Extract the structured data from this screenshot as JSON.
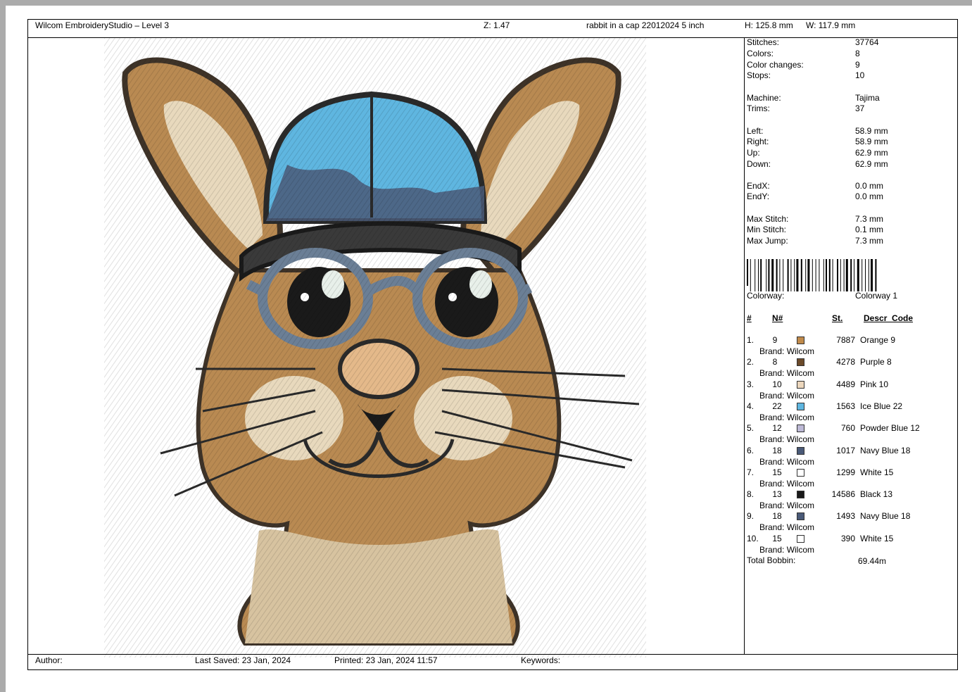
{
  "header": {
    "app": "Wilcom EmbroideryStudio – Level 3",
    "zoom": "Z: 1.47",
    "design_name": "rabbit in a cap 22012024 5 inch",
    "height": "H: 125.8 mm",
    "width": "W: 117.9 mm"
  },
  "stats": [
    {
      "label": "Stitches:",
      "value": "37764"
    },
    {
      "label": "Colors:",
      "value": "8"
    },
    {
      "label": "Color changes:",
      "value": "9"
    },
    {
      "label": "Stops:",
      "value": "10"
    },
    {
      "label": "Machine:",
      "value": "Tajima"
    },
    {
      "label": "Trims:",
      "value": "37"
    },
    {
      "label": "Left:",
      "value": "58.9 mm"
    },
    {
      "label": "Right:",
      "value": "58.9 mm"
    },
    {
      "label": "Up:",
      "value": "62.9 mm"
    },
    {
      "label": "Down:",
      "value": "62.9 mm"
    },
    {
      "label": "EndX:",
      "value": "0.0 mm"
    },
    {
      "label": "EndY:",
      "value": "0.0 mm"
    },
    {
      "label": "Max Stitch:",
      "value": "7.3 mm"
    },
    {
      "label": "Min Stitch:",
      "value": "0.1 mm"
    },
    {
      "label": "Max Jump:",
      "value": "7.3 mm"
    }
  ],
  "colorway": {
    "label": "Colorway:",
    "value": "Colorway 1"
  },
  "table_headers": {
    "num": "#",
    "n": "N#",
    "st": "St.",
    "desc": "Descr_Code"
  },
  "threads": [
    {
      "num": "1.",
      "n": "9",
      "color": "#c08a4a",
      "st": "7887",
      "desc": "Orange 9",
      "brand": "Brand: Wilcom"
    },
    {
      "num": "2.",
      "n": "8",
      "color": "#6b4a2a",
      "st": "4278",
      "desc": "Purple 8",
      "brand": "Brand: Wilcom"
    },
    {
      "num": "3.",
      "n": "10",
      "color": "#ecd7bd",
      "st": "4489",
      "desc": "Pink 10",
      "brand": "Brand: Wilcom"
    },
    {
      "num": "4.",
      "n": "22",
      "color": "#5fb6e0",
      "st": "1563",
      "desc": "Ice Blue 22",
      "brand": "Brand: Wilcom"
    },
    {
      "num": "5.",
      "n": "12",
      "color": "#bdb9d6",
      "st": "760",
      "desc": "Powder Blue 12",
      "brand": "Brand: Wilcom"
    },
    {
      "num": "6.",
      "n": "18",
      "color": "#4a5a78",
      "st": "1017",
      "desc": "Navy Blue 18",
      "brand": "Brand: Wilcom"
    },
    {
      "num": "7.",
      "n": "15",
      "color": "#ffffff",
      "st": "1299",
      "desc": "White 15",
      "brand": "Brand: Wilcom"
    },
    {
      "num": "8.",
      "n": "13",
      "color": "#1a1a1a",
      "st": "14586",
      "desc": "Black 13",
      "brand": "Brand: Wilcom"
    },
    {
      "num": "9.",
      "n": "18",
      "color": "#4a5a78",
      "st": "1493",
      "desc": "Navy Blue 18",
      "brand": "Brand: Wilcom"
    },
    {
      "num": "10.",
      "n": "15",
      "color": "#ffffff",
      "st": "390",
      "desc": "White 15",
      "brand": "Brand: Wilcom"
    }
  ],
  "bobbin": {
    "label": "Total Bobbin:",
    "value": "69.44m"
  },
  "footer": {
    "author": "Author:",
    "last_saved": "Last Saved: 23 Jan, 2024",
    "printed": "Printed: 23 Jan, 2024 11:57",
    "keywords": "Keywords:"
  },
  "design_colors": {
    "fur": "#b98a52",
    "fur_dark": "#4a3a2a",
    "fur_light": "#e8d9bd",
    "cap": "#5fb6e0",
    "cap_outline": "#2a2a2a",
    "glasses": "#6b7f96",
    "eye": "#1a1a1a"
  }
}
